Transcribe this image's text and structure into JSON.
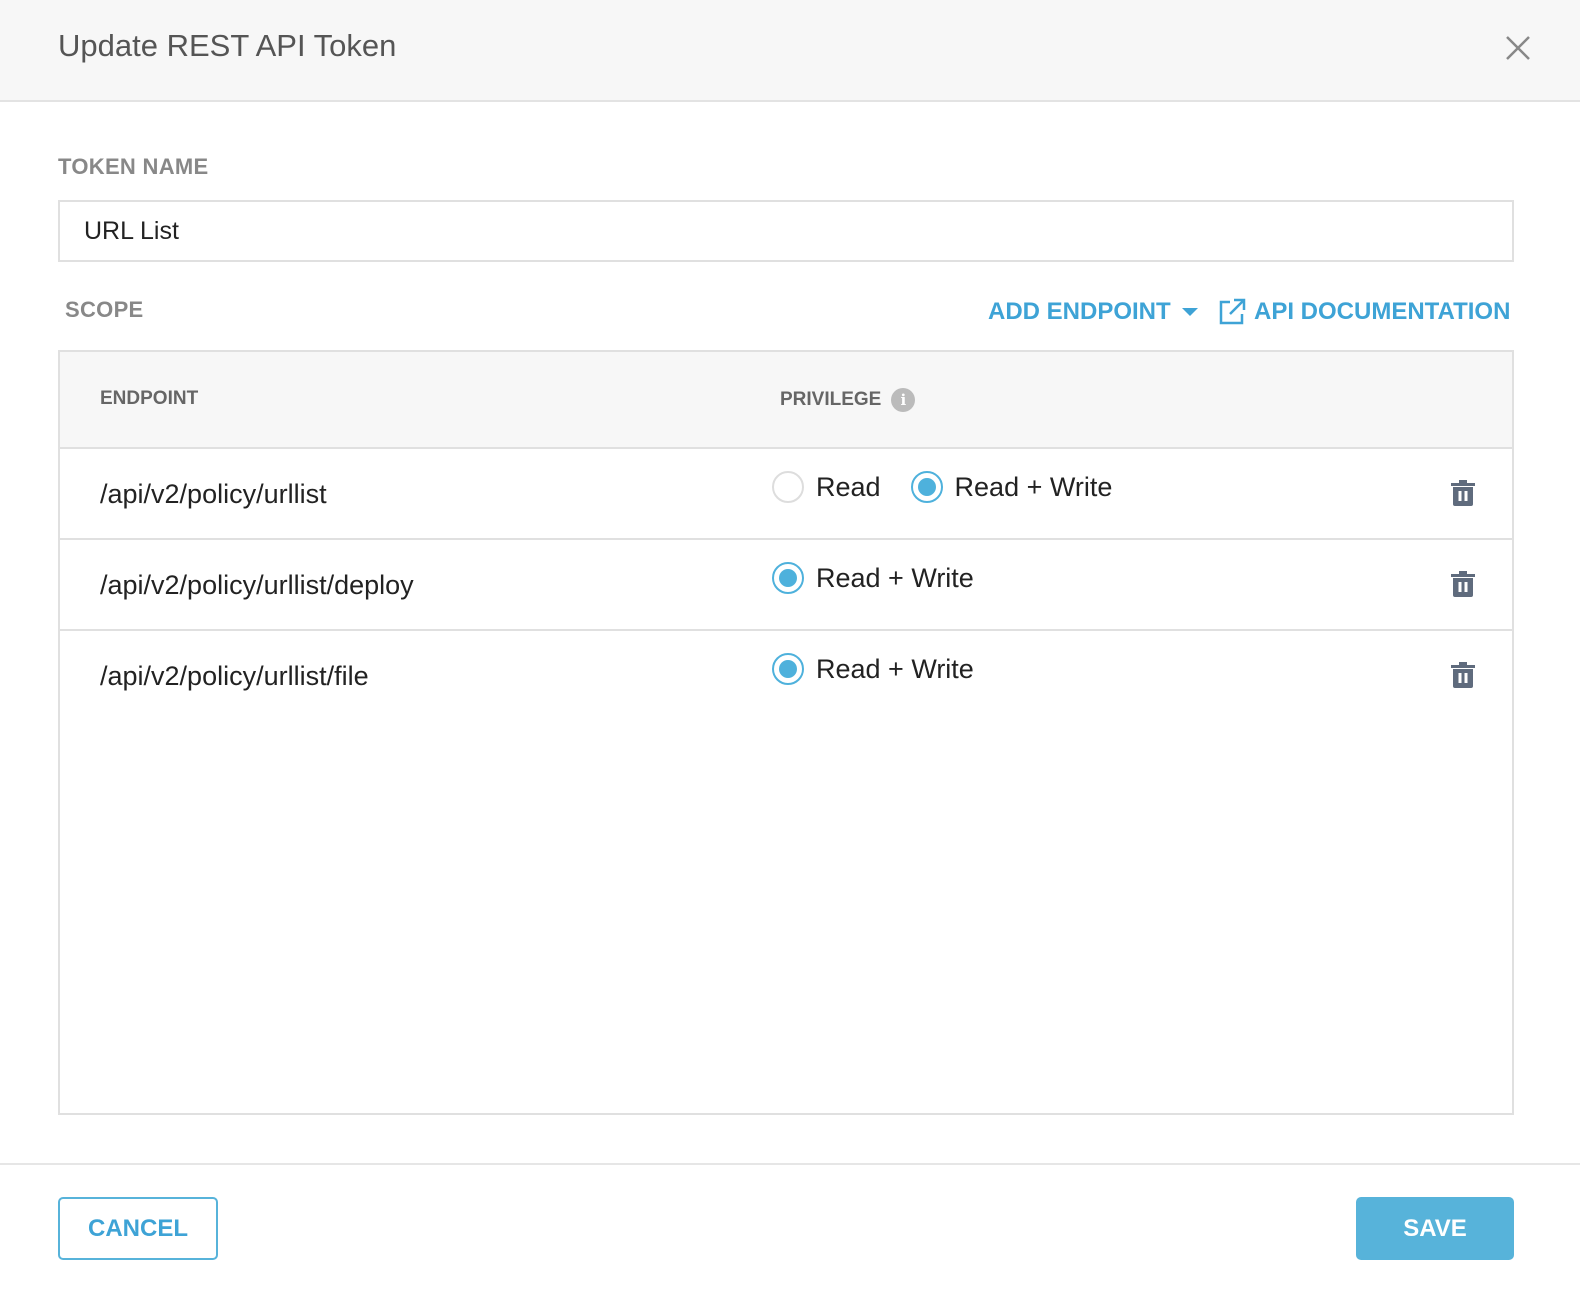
{
  "dialog": {
    "title": "Update REST API Token"
  },
  "token": {
    "label": "TOKEN NAME",
    "value": "URL List"
  },
  "scope": {
    "label": "SCOPE",
    "add_endpoint": "ADD ENDPOINT",
    "api_docs": "API DOCUMENTATION",
    "columns": {
      "endpoint": "ENDPOINT",
      "privilege": "PRIVILEGE"
    },
    "rows": [
      {
        "endpoint": "/api/v2/policy/urllist",
        "options": [
          "Read",
          "Read + Write"
        ],
        "selected": "Read + Write"
      },
      {
        "endpoint": "/api/v2/policy/urllist/deploy",
        "options": [
          "Read + Write"
        ],
        "selected": "Read + Write"
      },
      {
        "endpoint": "/api/v2/policy/urllist/file",
        "options": [
          "Read + Write"
        ],
        "selected": "Read + Write"
      }
    ]
  },
  "footer": {
    "cancel": "CANCEL",
    "save": "SAVE"
  },
  "colors": {
    "accent": "#57b3da",
    "icon": "#5f6b7d"
  }
}
